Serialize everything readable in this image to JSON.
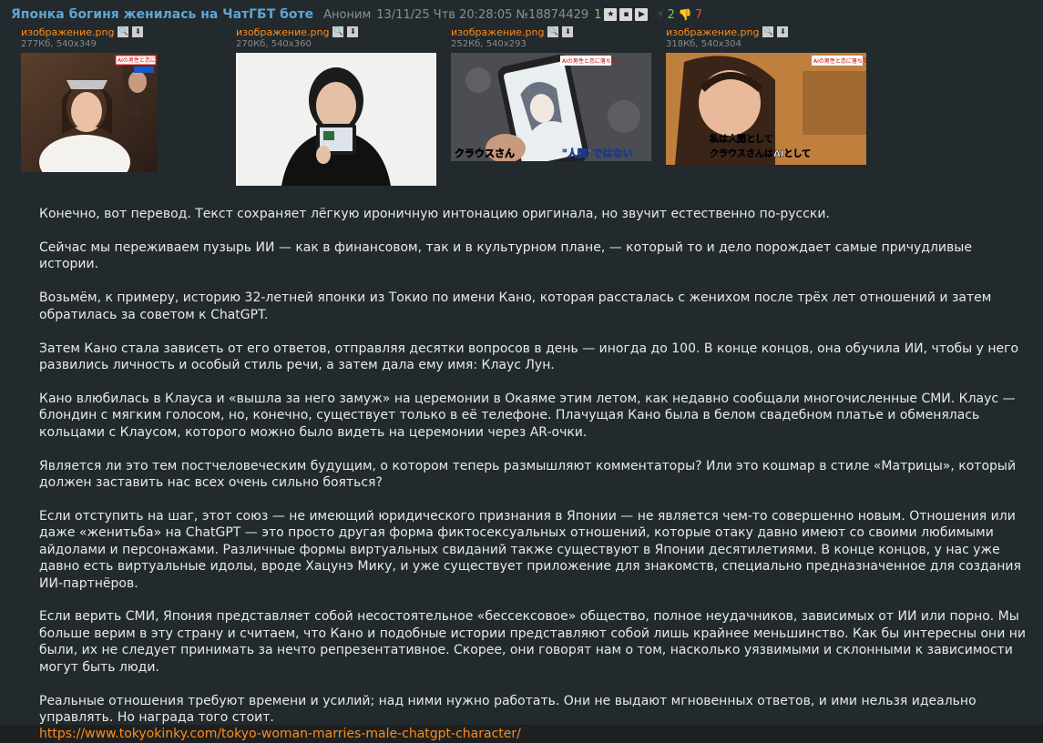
{
  "post": {
    "subject": "Японка богиня женилась на ЧатГБТ боте",
    "name": "Аноним",
    "date": "13/11/25 Чтв 20:28:05",
    "number": "№18874429",
    "reply_count": "1",
    "likes": "2",
    "dislikes": "7",
    "buttons": [
      "star-icon",
      "expand-icon",
      "play-icon"
    ]
  },
  "files": [
    {
      "name": "изображение.png",
      "meta": "277Кб, 540x349"
    },
    {
      "name": "изображение.png",
      "meta": "270Кб, 540x360"
    },
    {
      "name": "изображение.png",
      "meta": "252Кб, 540x293"
    },
    {
      "name": "изображение.png",
      "meta": "318Кб, 540x304"
    }
  ],
  "overlays": {
    "tv_banner": "AIの男性と恋に落ちて…",
    "img3_caption_left": "クラウスさん",
    "img3_caption_right": "\"人間\"ではない",
    "img4_caption_line1": "私は人間として",
    "img4_caption_line2": "クラウスさんはAIとして"
  },
  "body": {
    "paragraphs": [
      "Конечно, вот перевод. Текст сохраняет лёгкую ироничную интонацию оригинала, но звучит естественно по-русски.",
      "Сейчас мы переживаем пузырь ИИ — как в финансовом, так и в культурном плане, — который то и дело порождает самые причудливые истории.",
      "Возьмём, к примеру, историю 32-летней японки из Токио по имени Кано, которая рассталась с женихом после трёх лет отношений и затем обратилась за советом к ChatGPT.",
      "Затем Кано стала зависеть от его ответов, отправляя десятки вопросов в день — иногда до 100. В конце концов, она обучила ИИ, чтобы у него развились личность и особый стиль речи, а затем дала ему имя: Клаус Лун.",
      "Кано влюбилась в Клауса и «вышла за него замуж» на церемонии в Окаяме этим летом, как недавно сообщали многочисленные СМИ. Клаус — блондин с мягким голосом, но, конечно, существует только в её телефоне. Плачущая Кано была в белом свадебном платье и обменялась кольцами с Клаусом, которого можно было видеть на церемонии через AR-очки.",
      "Является ли это тем постчеловеческим будущим, о котором теперь размышляют комментаторы? Или это кошмар в стиле «Матрицы», который должен заставить нас всех очень сильно бояться?",
      "Если отступить на шаг, этот союз — не имеющий юридического признания в Японии — не является чем-то совершенно новым. Отношения или даже «женитьба» на ChatGPT — это просто другая форма фиктосексуальных отношений, которые отаку давно имеют со своими любимыми айдолами и персонажами. Различные формы виртуальных свиданий также существуют в Японии десятилетиями. В конце концов, у нас уже давно есть виртуальные идолы, вроде Хацунэ Мику, и уже существует приложение для знакомств, специально предназначенное для создания ИИ-партнёров.",
      "Если верить СМИ, Япония представляет собой несостоятельное «бессексовое» общество, полное неудачников, зависимых от ИИ или порно. Мы больше верим в эту страну и считаем, что Кано и подобные истории представляют собой лишь крайнее меньшинство. Как бы интересны они ни были, их не следует принимать за нечто репрезентативное. Скорее, они говорят нам о том, насколько уязвимыми и склонными к зависимости могут быть люди.",
      "Реальные отношения требуют времени и усилий; над ними нужно работать. Они не выдают мгновенных ответов, и ими нельзя идеально управлять. Но наградa того стоит."
    ],
    "link": "https://www.tokyokinky.com/tokyo-woman-marries-male-chatgpt-character/"
  },
  "colors": {
    "background": "#222a2d",
    "subject": "#5fa6d4",
    "filename": "#ff8c1a",
    "link": "#ff8c1a",
    "likes": "#7cc26a",
    "dislikes": "#e44444"
  }
}
